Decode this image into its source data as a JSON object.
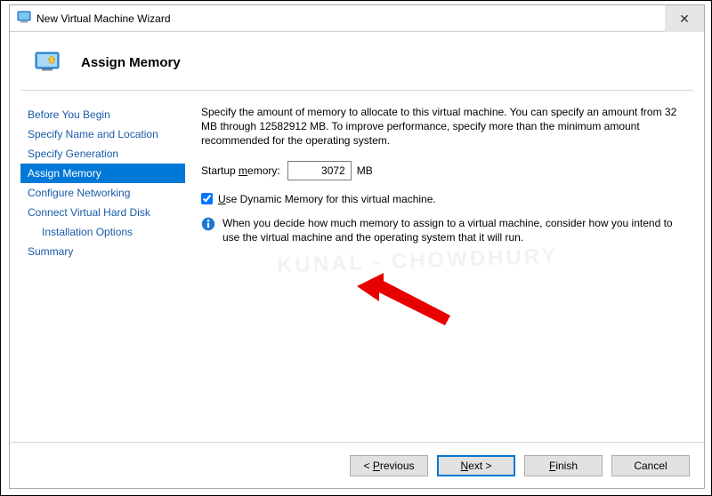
{
  "window": {
    "title": "New Virtual Machine Wizard",
    "close_glyph": "✕"
  },
  "header": {
    "title": "Assign Memory"
  },
  "sidebar": {
    "steps": [
      {
        "label": "Before You Begin",
        "active": false,
        "indent": false
      },
      {
        "label": "Specify Name and Location",
        "active": false,
        "indent": false
      },
      {
        "label": "Specify Generation",
        "active": false,
        "indent": false
      },
      {
        "label": "Assign Memory",
        "active": true,
        "indent": false
      },
      {
        "label": "Configure Networking",
        "active": false,
        "indent": false
      },
      {
        "label": "Connect Virtual Hard Disk",
        "active": false,
        "indent": false
      },
      {
        "label": "Installation Options",
        "active": false,
        "indent": true
      },
      {
        "label": "Summary",
        "active": false,
        "indent": false
      }
    ]
  },
  "content": {
    "description": "Specify the amount of memory to allocate to this virtual machine. You can specify an amount from 32 MB through 12582912 MB. To improve performance, specify more than the minimum amount recommended for the operating system.",
    "memory_label_pre": "Startup ",
    "memory_label_u": "m",
    "memory_label_post": "emory:",
    "memory_value": "3072",
    "memory_suffix": "MB",
    "dynamic_checked": true,
    "dynamic_label_u": "U",
    "dynamic_label_post": "se Dynamic Memory for this virtual machine.",
    "info_text": "When you decide how much memory to assign to a virtual machine, consider how you intend to use the virtual machine and the operating system that it will run."
  },
  "footer": {
    "previous_pre": "< ",
    "previous_u": "P",
    "previous_post": "revious",
    "next_u": "N",
    "next_post": "ext >",
    "finish_u": "F",
    "finish_post": "inish",
    "cancel": "Cancel"
  },
  "watermark": "KUNAL - CHOWDHURY"
}
